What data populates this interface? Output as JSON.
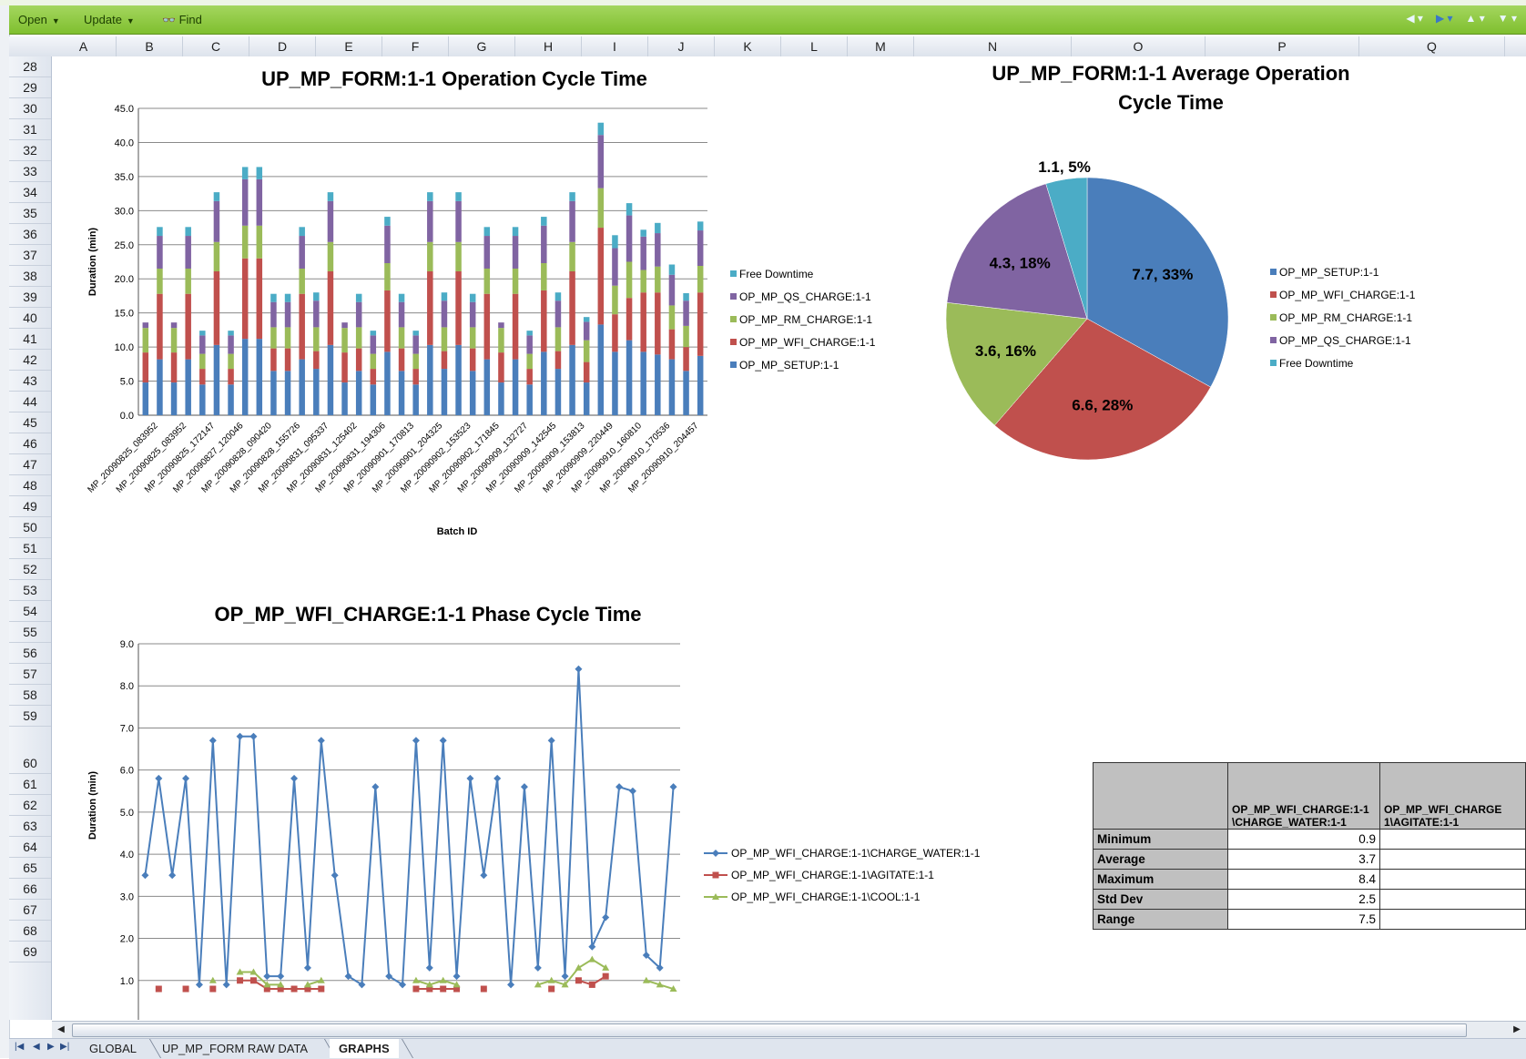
{
  "toolbar": {
    "open_label": "Open",
    "update_label": "Update",
    "find_label": "Find"
  },
  "columns": [
    "A",
    "B",
    "C",
    "D",
    "E",
    "F",
    "G",
    "H",
    "I",
    "J",
    "K",
    "L",
    "M",
    "N",
    "O",
    "P",
    "Q"
  ],
  "rows": [
    "28",
    "29",
    "30",
    "31",
    "32",
    "33",
    "34",
    "35",
    "36",
    "37",
    "38",
    "39",
    "40",
    "41",
    "42",
    "43",
    "44",
    "45",
    "46",
    "47",
    "48",
    "49",
    "50",
    "51",
    "52",
    "53",
    "54",
    "55",
    "56",
    "57",
    "58",
    "59",
    "60",
    "61",
    "62",
    "63",
    "64",
    "65",
    "66",
    "67",
    "68",
    "69"
  ],
  "charts": {
    "cycle_time_title": "UP_MP_FORM:1-1 Operation Cycle Time",
    "pie_title_line1": "UP_MP_FORM:1-1  Average Operation",
    "pie_title_line2": "Cycle Time",
    "phase_title": "OP_MP_WFI_CHARGE:1-1 Phase Cycle Time"
  },
  "chart_data": [
    {
      "type": "bar",
      "stacked": true,
      "title": "UP_MP_FORM:1-1 Operation Cycle Time",
      "xlabel": "Batch ID",
      "ylabel": "Duration (min)",
      "ylim": [
        0,
        45
      ],
      "yticks": [
        "0.0",
        "5.0",
        "10.0",
        "15.0",
        "20.0",
        "25.0",
        "30.0",
        "35.0",
        "40.0",
        "45.0"
      ],
      "grid": true,
      "legend_position": "right",
      "categories": [
        "MP_20090825_083952",
        "MP_20090825_083952",
        "MP_20090825_172147",
        "MP_20090827_120046",
        "MP_20090828_090420",
        "MP_20090828_155726",
        "MP_20090831_095337",
        "MP_20090831_125402",
        "MP_20090831_194306",
        "MP_20090901_170813",
        "MP_20090901_204325",
        "MP_20090902_153523",
        "MP_20090902_171845",
        "MP_20090909_132727",
        "MP_20090909_142545",
        "MP_20090909_153813",
        "MP_20090909_220449",
        "MP_20090910_160810",
        "MP_20090910_170536",
        "MP_20090910_204457"
      ],
      "series": [
        {
          "name": "OP_MP_SETUP:1-1",
          "color": "#4a7ebb",
          "values": [
            4.8,
            8.2,
            4.8,
            8.2,
            4.5,
            10.3,
            4.5,
            11.2,
            11.2,
            6.5,
            6.5,
            8.2,
            6.8,
            10.3,
            4.8,
            6.5,
            4.5,
            9.3,
            6.5,
            4.5,
            10.3,
            6.8,
            10.3,
            6.5,
            8.2,
            4.8,
            8.2,
            4.5,
            9.3,
            6.8,
            10.3,
            4.8,
            13.3,
            9.3,
            11.0,
            9.3,
            8.9,
            8.2,
            6.5,
            8.7
          ]
        },
        {
          "name": "OP_MP_WFI_CHARGE:1-1",
          "color": "#c0504d",
          "values": [
            4.4,
            9.6,
            4.4,
            9.6,
            2.3,
            10.8,
            2.3,
            11.8,
            11.8,
            3.3,
            3.3,
            9.6,
            2.6,
            10.8,
            4.4,
            3.3,
            2.3,
            9.0,
            3.3,
            2.3,
            10.8,
            2.6,
            10.8,
            3.3,
            9.6,
            4.4,
            9.6,
            2.3,
            9.0,
            2.6,
            10.8,
            3.0,
            14.2,
            5.5,
            6.2,
            8.7,
            9.1,
            4.4,
            3.5,
            9.3
          ]
        },
        {
          "name": "OP_MP_RM_CHARGE:1-1",
          "color": "#9bbb59",
          "values": [
            3.6,
            3.7,
            3.6,
            3.7,
            2.2,
            4.3,
            2.2,
            4.8,
            4.8,
            3.1,
            3.1,
            3.7,
            3.5,
            4.3,
            3.6,
            3.1,
            2.2,
            4.0,
            3.1,
            2.2,
            4.3,
            3.5,
            4.3,
            3.1,
            3.7,
            3.6,
            3.7,
            2.2,
            4.0,
            3.5,
            4.3,
            3.2,
            5.8,
            4.2,
            5.3,
            3.3,
            3.8,
            3.5,
            3.1,
            3.9
          ]
        },
        {
          "name": "OP_MP_QS_CHARGE:1-1",
          "color": "#8064a2",
          "values": [
            0.8,
            4.8,
            0.8,
            4.8,
            2.7,
            6.0,
            2.7,
            6.8,
            6.8,
            3.7,
            3.7,
            4.8,
            3.9,
            6.0,
            0.8,
            3.7,
            2.7,
            5.5,
            3.7,
            2.7,
            6.0,
            3.9,
            6.0,
            3.7,
            4.8,
            0.8,
            4.8,
            2.7,
            5.5,
            3.9,
            6.0,
            2.7,
            7.8,
            5.5,
            6.8,
            4.9,
            4.9,
            4.5,
            3.7,
            5.2
          ]
        },
        {
          "name": "Free Downtime",
          "color": "#4bacc6",
          "values": [
            0.0,
            1.3,
            0.0,
            1.3,
            0.7,
            1.3,
            0.7,
            1.8,
            1.8,
            1.2,
            1.2,
            1.3,
            1.2,
            1.3,
            0.0,
            1.2,
            0.7,
            1.3,
            1.2,
            0.7,
            1.3,
            1.2,
            1.3,
            1.2,
            1.3,
            0.0,
            1.3,
            0.7,
            1.3,
            1.2,
            1.3,
            0.7,
            1.8,
            1.9,
            1.8,
            1.0,
            1.5,
            1.5,
            1.1,
            1.3
          ]
        }
      ]
    },
    {
      "type": "pie",
      "title": "UP_MP_FORM:1-1  Average Operation Cycle Time",
      "legend_position": "right",
      "slices": [
        {
          "name": "OP_MP_SETUP:1-1",
          "value": 7.7,
          "label": "7.7, 33%",
          "color": "#4a7ebb"
        },
        {
          "name": "OP_MP_WFI_CHARGE:1-1",
          "value": 6.6,
          "label": "6.6, 28%",
          "color": "#c0504d"
        },
        {
          "name": "OP_MP_RM_CHARGE:1-1",
          "value": 3.6,
          "label": "3.6, 16%",
          "color": "#9bbb59"
        },
        {
          "name": "OP_MP_QS_CHARGE:1-1",
          "value": 4.3,
          "label": "4.3, 18%",
          "color": "#8064a2"
        },
        {
          "name": "Free Downtime",
          "value": 1.1,
          "label": "1.1, 5%",
          "color": "#4bacc6"
        }
      ]
    },
    {
      "type": "line",
      "title": "OP_MP_WFI_CHARGE:1-1 Phase Cycle Time",
      "ylabel": "Duration (min)",
      "ylim": [
        0,
        9
      ],
      "yticks": [
        "1.0",
        "2.0",
        "3.0",
        "4.0",
        "5.0",
        "6.0",
        "7.0",
        "8.0",
        "9.0"
      ],
      "grid": true,
      "legend_position": "right",
      "series": [
        {
          "name": "OP_MP_WFI_CHARGE:1-1\\CHARGE_WATER:1-1",
          "color": "#4a7ebb",
          "marker": "diamond",
          "values": [
            3.5,
            5.8,
            3.5,
            5.8,
            0.9,
            6.7,
            0.9,
            6.8,
            6.8,
            1.1,
            1.1,
            5.8,
            1.3,
            6.7,
            3.5,
            1.1,
            0.9,
            5.6,
            1.1,
            0.9,
            6.7,
            1.3,
            6.7,
            1.1,
            5.8,
            3.5,
            5.8,
            0.9,
            5.6,
            1.3,
            6.7,
            1.1,
            8.4,
            1.8,
            2.5,
            5.6,
            5.5,
            1.6,
            1.3,
            5.6
          ]
        },
        {
          "name": "OP_MP_WFI_CHARGE:1-1\\AGITATE:1-1",
          "color": "#c0504d",
          "marker": "square",
          "values": [
            null,
            0.8,
            null,
            0.8,
            null,
            0.8,
            null,
            1.0,
            1.0,
            0.8,
            0.8,
            0.8,
            0.8,
            0.8,
            null,
            null,
            null,
            null,
            null,
            null,
            0.8,
            0.8,
            0.8,
            0.8,
            null,
            0.8,
            null,
            null,
            null,
            null,
            0.8,
            null,
            1.0,
            0.9,
            1.1,
            null,
            null,
            null,
            null,
            null
          ]
        },
        {
          "name": "OP_MP_WFI_CHARGE:1-1\\COOL:1-1",
          "color": "#9bbb59",
          "marker": "triangle",
          "values": [
            null,
            null,
            null,
            null,
            null,
            1.0,
            null,
            1.2,
            1.2,
            0.9,
            0.9,
            null,
            0.9,
            1.0,
            null,
            null,
            null,
            null,
            null,
            null,
            1.0,
            0.9,
            1.0,
            0.9,
            null,
            null,
            null,
            null,
            null,
            0.9,
            1.0,
            0.9,
            1.3,
            1.5,
            1.3,
            null,
            null,
            1.0,
            0.9,
            0.8
          ]
        }
      ]
    }
  ],
  "stats_table": {
    "headers": [
      "OP_MP_WFI_CHARGE:1-1 \\CHARGE_WATER:1-1",
      "OP_MP_WFI_CHARGE 1\\AGITATE:1-1"
    ],
    "rows": [
      {
        "label": "Minimum",
        "value": "0.9"
      },
      {
        "label": "Average",
        "value": "3.7"
      },
      {
        "label": "Maximum",
        "value": "8.4"
      },
      {
        "label": "Std Dev",
        "value": "2.5"
      },
      {
        "label": "Range",
        "value": "7.5"
      }
    ]
  },
  "sheet_tabs": [
    {
      "label": "GLOBAL",
      "active": false
    },
    {
      "label": "UP_MP_FORM RAW DATA",
      "active": false
    },
    {
      "label": "GRAPHS",
      "active": true
    }
  ]
}
